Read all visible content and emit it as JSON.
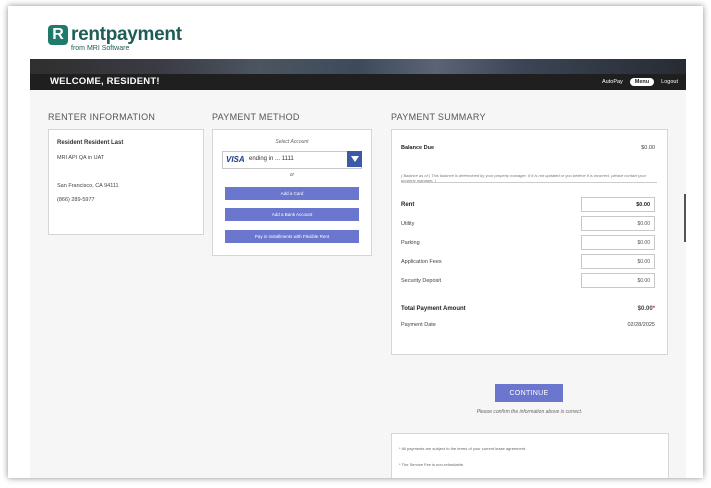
{
  "brand": {
    "name": "rentpayment",
    "subtitle": "from MRI Software",
    "logo_letter": "R",
    "color": "#1e5d55"
  },
  "header": {
    "welcome": "WELCOME, RESIDENT!",
    "nav": {
      "autopay": "AutoPay",
      "menu": "Menu",
      "logout": "Logout"
    }
  },
  "renter": {
    "title": "RENTER INFORMATION",
    "name": "Resident Resident Last",
    "company": "MRI API QA in UAT",
    "city": "San Francisco, CA 94111",
    "phone": "(866) 289-5977"
  },
  "payment_method": {
    "title": "PAYMENT METHOD",
    "select_label": "Select Account",
    "card_brand": "VISA",
    "card_text": "ending in ... 1111",
    "or_label": "or",
    "add_card": "Add a Card",
    "add_bank": "Add a Bank Account",
    "flex": "Pay in installments with Flexible Rent",
    "accent": "#6b76cf"
  },
  "summary": {
    "title": "PAYMENT SUMMARY",
    "balance_label": "Balance Due",
    "balance_value": "$0.00",
    "balance_note": "( Balance as of ) This balance is determined by your property manager. If it is not updated or you believe it is incorrect, please contact your property manager. )",
    "rows": [
      {
        "label": "Rent",
        "value": "$0.00"
      },
      {
        "label": "Utility",
        "value": "$0.00"
      },
      {
        "label": "Parking",
        "value": "$0.00"
      },
      {
        "label": "Application Fees",
        "value": "$0.00"
      },
      {
        "label": "Security Deposit",
        "value": "$0.00"
      }
    ],
    "total_label": "Total Payment Amount",
    "total_value": "$0.00",
    "total_star": "*",
    "date_label": "Payment Date",
    "date_value": "02/28/2025"
  },
  "actions": {
    "continue": "CONTINUE",
    "confirm_note": "Please confirm the information above is correct."
  },
  "disclaimer": {
    "line1": "* All payments are subject to the terms of your current lease agreement.",
    "line2": "* The Service Fee is non-refundable."
  }
}
